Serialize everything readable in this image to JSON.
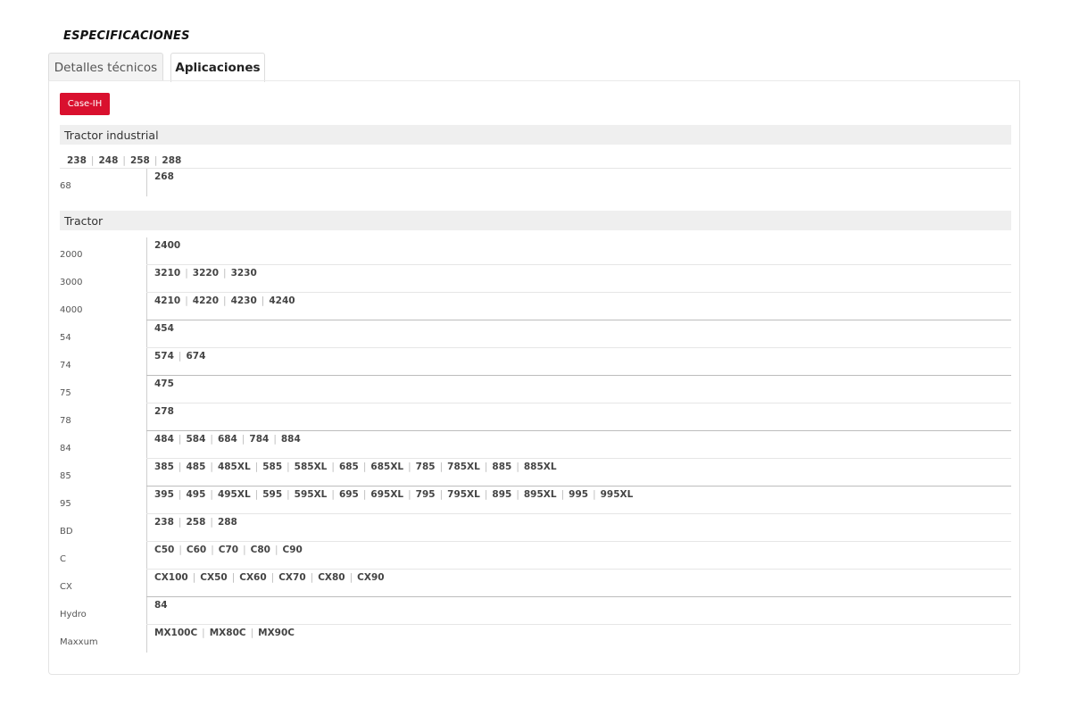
{
  "title": "ESPECIFICACIONES",
  "tabs": [
    {
      "label": "Detalles técnicos"
    },
    {
      "label": "Aplicaciones"
    }
  ],
  "brand_button": "Case-IH",
  "sections": {
    "industrial": {
      "title": "Tractor industrial",
      "top_models": [
        "238",
        "248",
        "258",
        "288"
      ],
      "rows": [
        {
          "label": "68",
          "models": [
            "268"
          ]
        }
      ]
    },
    "tractor": {
      "title": "Tractor",
      "rows": [
        {
          "label": "2000",
          "models": [
            "2400"
          ]
        },
        {
          "label": "3000",
          "models": [
            "3210",
            "3220",
            "3230"
          ]
        },
        {
          "label": "4000",
          "models": [
            "4210",
            "4220",
            "4230",
            "4240"
          ]
        },
        {
          "label": "54",
          "models": [
            "454"
          ]
        },
        {
          "label": "74",
          "models": [
            "574",
            "674"
          ]
        },
        {
          "label": "75",
          "models": [
            "475"
          ]
        },
        {
          "label": "78",
          "models": [
            "278"
          ]
        },
        {
          "label": "84",
          "models": [
            "484",
            "584",
            "684",
            "784",
            "884"
          ]
        },
        {
          "label": "85",
          "models": [
            "385",
            "485",
            "485XL",
            "585",
            "585XL",
            "685",
            "685XL",
            "785",
            "785XL",
            "885",
            "885XL"
          ]
        },
        {
          "label": "95",
          "models": [
            "395",
            "495",
            "495XL",
            "595",
            "595XL",
            "695",
            "695XL",
            "795",
            "795XL",
            "895",
            "895XL",
            "995",
            "995XL"
          ]
        },
        {
          "label": "BD",
          "models": [
            "238",
            "258",
            "288"
          ]
        },
        {
          "label": "C",
          "models": [
            "C50",
            "C60",
            "C70",
            "C80",
            "C90"
          ]
        },
        {
          "label": "CX",
          "models": [
            "CX100",
            "CX50",
            "CX60",
            "CX70",
            "CX80",
            "CX90"
          ]
        },
        {
          "label": "Hydro",
          "models": [
            "84"
          ]
        },
        {
          "label": "Maxxum",
          "models": [
            "MX100C",
            "MX80C",
            "MX90C"
          ]
        }
      ]
    }
  },
  "colors": {
    "brand": "#d9102e",
    "header_bg": "#efefef"
  }
}
